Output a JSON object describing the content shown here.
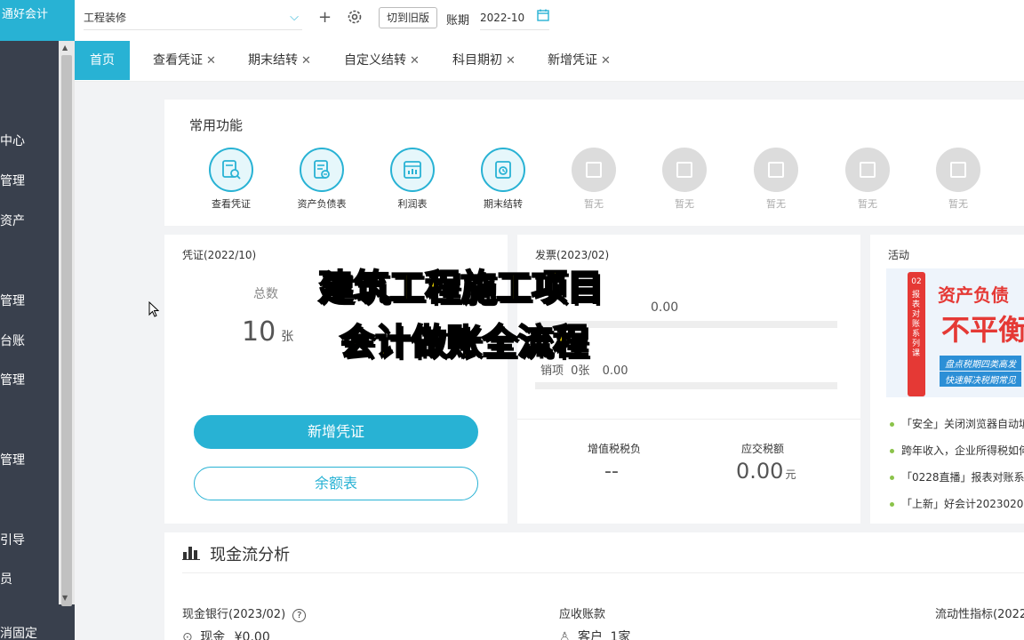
{
  "sidebar": {
    "brand": "通好会计",
    "items": [
      "中心",
      "管理",
      "资产",
      "管理",
      "台账",
      "管理",
      "管理",
      "引导",
      "员",
      "消固定"
    ]
  },
  "topbar": {
    "company": "工程装修",
    "switch_label": "切到旧版",
    "period_label": "账期",
    "period_value": "2022-10"
  },
  "tabs": [
    {
      "label": "首页"
    },
    {
      "label": "查看凭证"
    },
    {
      "label": "期末结转"
    },
    {
      "label": "自定义结转"
    },
    {
      "label": "科目期初"
    },
    {
      "label": "新增凭证"
    }
  ],
  "common_functions": {
    "title": "常用功能",
    "items": [
      "查看凭证",
      "资产负债表",
      "利润表",
      "期末结转",
      "暂无",
      "暂无",
      "暂无",
      "暂无",
      "暂无"
    ]
  },
  "voucher": {
    "title": "凭证(2022/10)",
    "total_label": "总数",
    "total_value": "10",
    "unit": "张",
    "add_button": "新增凭证",
    "balance_button": "余额表"
  },
  "invoice": {
    "title": "发票(2023/02)",
    "amount_1": "0.00",
    "row_label": "销项",
    "row_count": "0张",
    "amount_2": "0.00",
    "vat_label": "增值税税负",
    "vat_value": "--",
    "tax_label": "应交税额",
    "tax_value": "0.00",
    "tax_unit": "元"
  },
  "activity": {
    "title": "活动",
    "banner_title": "资产负债",
    "banner_big": "不平衡",
    "banner_side": "报表对账系列课",
    "banner_num": "02",
    "banner_line1": "盘点税期四类高发",
    "banner_line2": "快速解决税期常见",
    "news": [
      "「安全」关闭浏览器自动填",
      "跨年收入，企业所得税如何",
      "「0228直播」报表对账系",
      "「上新」好会计2023020"
    ]
  },
  "cashflow": {
    "title": "现金流分析",
    "bank_label": "现金银行(2023/02)",
    "cash_label": "现金",
    "cash_value": "¥0.00",
    "receivable_label": "应收账款",
    "customer_label": "客户",
    "customer_value": "1家",
    "liquidity_label": "流动性指标(2022"
  },
  "overlay": {
    "line1": "建筑工程施工项目",
    "line2": "会计做账全流程"
  },
  "colors": {
    "accent": "#28b2d4",
    "sidebar": "#39404d"
  }
}
